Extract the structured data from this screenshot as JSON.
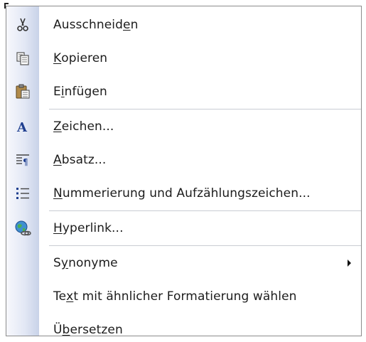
{
  "menu": {
    "items": [
      {
        "label": "Ausschneiden",
        "u": 10,
        "icon": "scissors-icon"
      },
      {
        "label": "Kopieren",
        "u": 0,
        "icon": "copy-icon"
      },
      {
        "label": "Einfügen",
        "u": 1,
        "icon": "paste-icon"
      },
      {
        "label": "Zeichen...",
        "u": 0,
        "icon": "font-icon"
      },
      {
        "label": "Absatz...",
        "u": 0,
        "icon": "paragraph-icon"
      },
      {
        "label": "Nummerierung und Aufzählungszeichen...",
        "u": 0,
        "icon": "bullet-list-icon"
      },
      {
        "label": "Hyperlink...",
        "u": 0,
        "icon": "hyperlink-globe-icon"
      },
      {
        "label": "Synonyme",
        "u": 1,
        "icon": ""
      },
      {
        "label": "Text mit ähnlicher Formatierung wählen",
        "u": 2,
        "icon": ""
      },
      {
        "label": "Übersetzen",
        "u": 1,
        "icon": ""
      }
    ]
  }
}
